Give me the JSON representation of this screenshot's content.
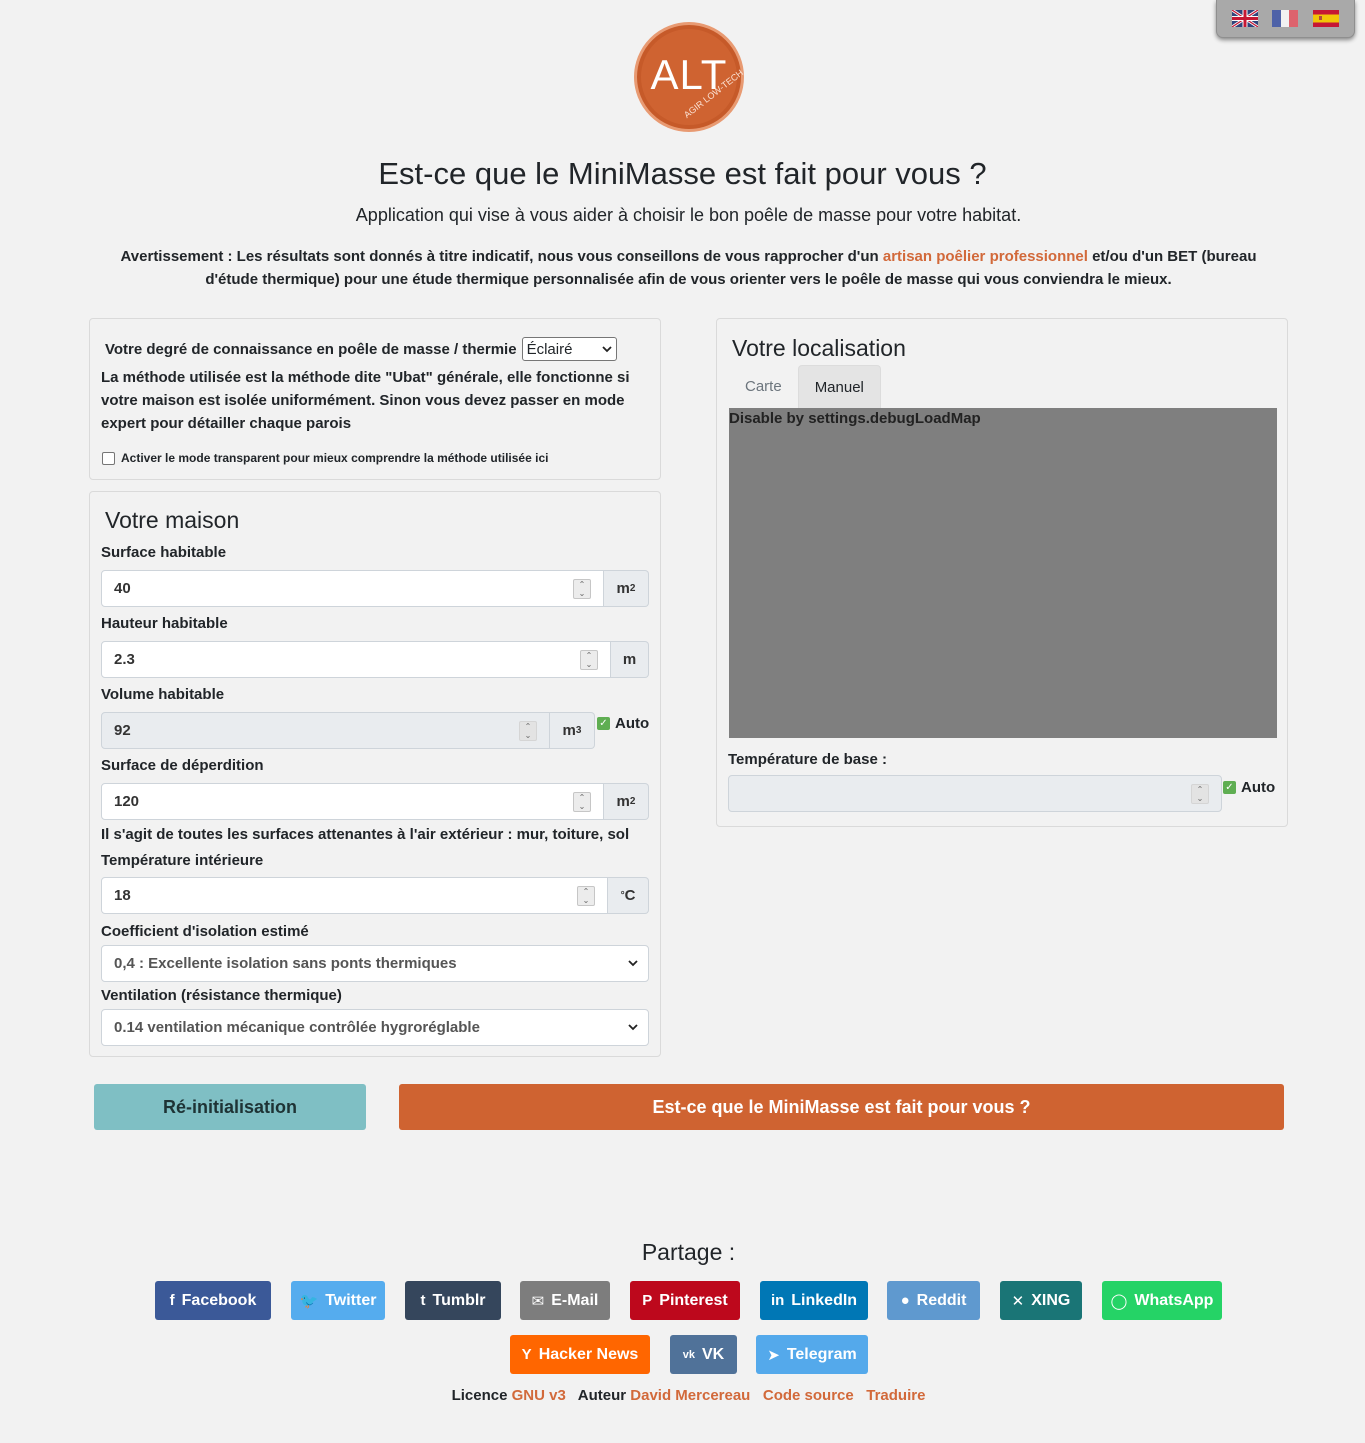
{
  "lang_flags": [
    {
      "name": "uk-flag-icon",
      "alt": "English"
    },
    {
      "name": "fr-flag-icon",
      "alt": "Français"
    },
    {
      "name": "es-flag-icon",
      "alt": "Español"
    }
  ],
  "logo": {
    "text": "ALT",
    "sub": "AGIR LOW-TECH"
  },
  "header": {
    "title": "Est-ce que le MiniMasse est fait pour vous ?",
    "subtitle": "Application qui vise à vous aider à choisir le bon poêle de masse pour votre habitat.",
    "warning_before": "Avertissement : Les résultats sont donnés à titre indicatif, nous vous conseillons de vous rapprocher d'un ",
    "warning_link": "artisan poêlier professionnel",
    "warning_after": " et/ou d'un BET (bureau d'étude thermique) pour une étude thermique personnalisée afin de vous orienter vers le poêle de masse qui vous conviendra le mieux."
  },
  "knowledge": {
    "label": "Votre degré de connaissance en poêle de masse / thermie",
    "selected": "Éclairé",
    "method_text": "La méthode utilisée est la méthode dite \"Ubat\" générale, elle fonctionne si votre maison est isolée uniformément. Sinon vous devez passer en mode expert pour détailler chaque parois",
    "transparent_label": "Activer le mode transparent pour mieux comprendre la méthode utilisée ici"
  },
  "maison": {
    "title": "Votre maison",
    "surface_label": "Surface habitable",
    "surface_value": "40",
    "surface_unit": "m",
    "hauteur_label": "Hauteur habitable",
    "hauteur_value": "2.3",
    "hauteur_unit": "m",
    "volume_label": "Volume habitable",
    "volume_value": "92",
    "volume_unit": "m",
    "auto_label": "Auto",
    "deperdition_label": "Surface de déperdition",
    "deperdition_value": "120",
    "deperdition_unit": "m",
    "deperdition_help": "Il s'agit de toutes les surfaces attenantes à l'air extérieur : mur, toiture, sol",
    "temp_label": "Température intérieure",
    "temp_value": "18",
    "temp_unit": "C",
    "coef_label": "Coefficient d'isolation estimé",
    "coef_selected": "0,4 : Excellente isolation sans ponts thermiques",
    "ventilation_label": "Ventilation (résistance thermique)",
    "ventilation_selected": "0.14 ventilation mécanique contrôlée hygroréglable"
  },
  "localisation": {
    "title": "Votre localisation",
    "tab_carte": "Carte",
    "tab_manuel": "Manuel",
    "map_message": "Disable by settings.debugLoadMap",
    "temp_base_label": "Température de base :",
    "temp_base_value": "",
    "auto_label": "Auto"
  },
  "actions": {
    "reset": "Ré-initialisation",
    "submit": "Est-ce que le MiniMasse est fait pour vous ?"
  },
  "share": {
    "title": "Partage :",
    "buttons": [
      {
        "label": "Facebook",
        "icon": "f",
        "color": "#3b5998"
      },
      {
        "label": "Twitter",
        "icon": "🐦",
        "color": "#55acee"
      },
      {
        "label": "Tumblr",
        "icon": "t",
        "color": "#35465c"
      },
      {
        "label": "E-Mail",
        "icon": "✉",
        "color": "#7d7d7d"
      },
      {
        "label": "Pinterest",
        "icon": "P",
        "color": "#bd081c"
      },
      {
        "label": "LinkedIn",
        "icon": "in",
        "color": "#0077b5"
      },
      {
        "label": "Reddit",
        "icon": "●",
        "color": "#5f99cf"
      },
      {
        "label": "XING",
        "icon": "✕",
        "color": "#1a7576"
      },
      {
        "label": "WhatsApp",
        "icon": "◯",
        "color": "#25d366"
      },
      {
        "label": "Hacker News",
        "icon": "Y",
        "color": "#ff6600"
      },
      {
        "label": "VK",
        "icon": "vk",
        "color": "#507299"
      },
      {
        "label": "Telegram",
        "icon": "➤",
        "color": "#54a9eb"
      }
    ]
  },
  "footer": {
    "licence_label": "Licence",
    "licence_link": "GNU v3",
    "author_label": "Auteur",
    "author_link": "David Mercereau",
    "source_link": "Code source",
    "translate_link": "Traduire"
  }
}
